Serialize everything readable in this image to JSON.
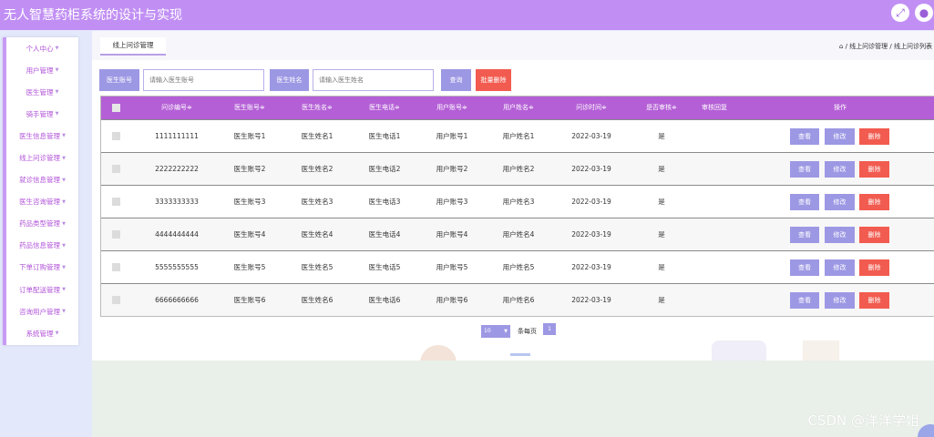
{
  "app": {
    "title": "无人智慧药柜系统的设计与实现"
  },
  "icons": {
    "fullscreen": "expand-arrows-icon",
    "user": "user-avatar-icon",
    "home": "home-icon"
  },
  "colors": {
    "header": "#c18ff4",
    "table_header": "#b45fd6",
    "primary": "#9d98e4",
    "danger": "#f25b4f"
  },
  "sidebar": {
    "items": [
      {
        "label": "个人中心"
      },
      {
        "label": "用户管理"
      },
      {
        "label": "医生管理"
      },
      {
        "label": "骑手管理"
      },
      {
        "label": "医生信息管理"
      },
      {
        "label": "线上问诊管理"
      },
      {
        "label": "就诊信息管理"
      },
      {
        "label": "医生咨询管理"
      },
      {
        "label": "药品类型管理"
      },
      {
        "label": "药品信息管理"
      },
      {
        "label": "下单订购管理"
      },
      {
        "label": "订单配送管理"
      },
      {
        "label": "咨询用户管理"
      },
      {
        "label": "系统管理"
      }
    ]
  },
  "tab": {
    "label": "线上问诊管理"
  },
  "breadcrumb": {
    "text": "/ 线上问诊管理 / 线上问诊列表"
  },
  "search": {
    "doctor_account_label": "医生账号",
    "doctor_account_placeholder": "请输入医生账号",
    "doctor_name_label": "医生姓名",
    "doctor_name_placeholder": "请输入医生姓名",
    "query_button": "查询",
    "bulk_delete_button": "批量删除"
  },
  "table": {
    "headers": {
      "consult_no": "问诊编号≑",
      "doctor_account": "医生账号≑",
      "doctor_name": "医生姓名≑",
      "doctor_phone": "医生电话≑",
      "user_account": "用户账号≑",
      "user_name": "用户姓名≑",
      "consult_time": "问诊时间≑",
      "reviewed": "是否审核≑",
      "review_reply": "审核回复",
      "actions": "操作"
    },
    "rows": [
      {
        "consult_no": "1111111111",
        "doctor_account": "医生账号1",
        "doctor_name": "医生姓名1",
        "doctor_phone": "医生电话1",
        "user_account": "用户账号1",
        "user_name": "用户姓名1",
        "consult_time": "2022-03-19",
        "reviewed": "是"
      },
      {
        "consult_no": "2222222222",
        "doctor_account": "医生账号2",
        "doctor_name": "医生姓名2",
        "doctor_phone": "医生电话2",
        "user_account": "用户账号2",
        "user_name": "用户姓名2",
        "consult_time": "2022-03-19",
        "reviewed": "是"
      },
      {
        "consult_no": "3333333333",
        "doctor_account": "医生账号3",
        "doctor_name": "医生姓名3",
        "doctor_phone": "医生电话3",
        "user_account": "用户账号3",
        "user_name": "用户姓名3",
        "consult_time": "2022-03-19",
        "reviewed": "是"
      },
      {
        "consult_no": "4444444444",
        "doctor_account": "医生账号4",
        "doctor_name": "医生姓名4",
        "doctor_phone": "医生电话4",
        "user_account": "用户账号4",
        "user_name": "用户姓名4",
        "consult_time": "2022-03-19",
        "reviewed": "是"
      },
      {
        "consult_no": "5555555555",
        "doctor_account": "医生账号5",
        "doctor_name": "医生姓名5",
        "doctor_phone": "医生电话5",
        "user_account": "用户账号5",
        "user_name": "用户姓名5",
        "consult_time": "2022-03-19",
        "reviewed": "是"
      },
      {
        "consult_no": "6666666666",
        "doctor_account": "医生账号6",
        "doctor_name": "医生姓名6",
        "doctor_phone": "医生电话6",
        "user_account": "用户账号6",
        "user_name": "用户姓名6",
        "consult_time": "2022-03-19",
        "reviewed": "是"
      }
    ],
    "row_actions": {
      "view": "查看",
      "edit": "修改",
      "delete": "删除"
    }
  },
  "pagination": {
    "page_size": "10",
    "page_size_suffix": "条每页",
    "current_page": "1"
  },
  "watermark": "CSDN @洋洋学姐"
}
